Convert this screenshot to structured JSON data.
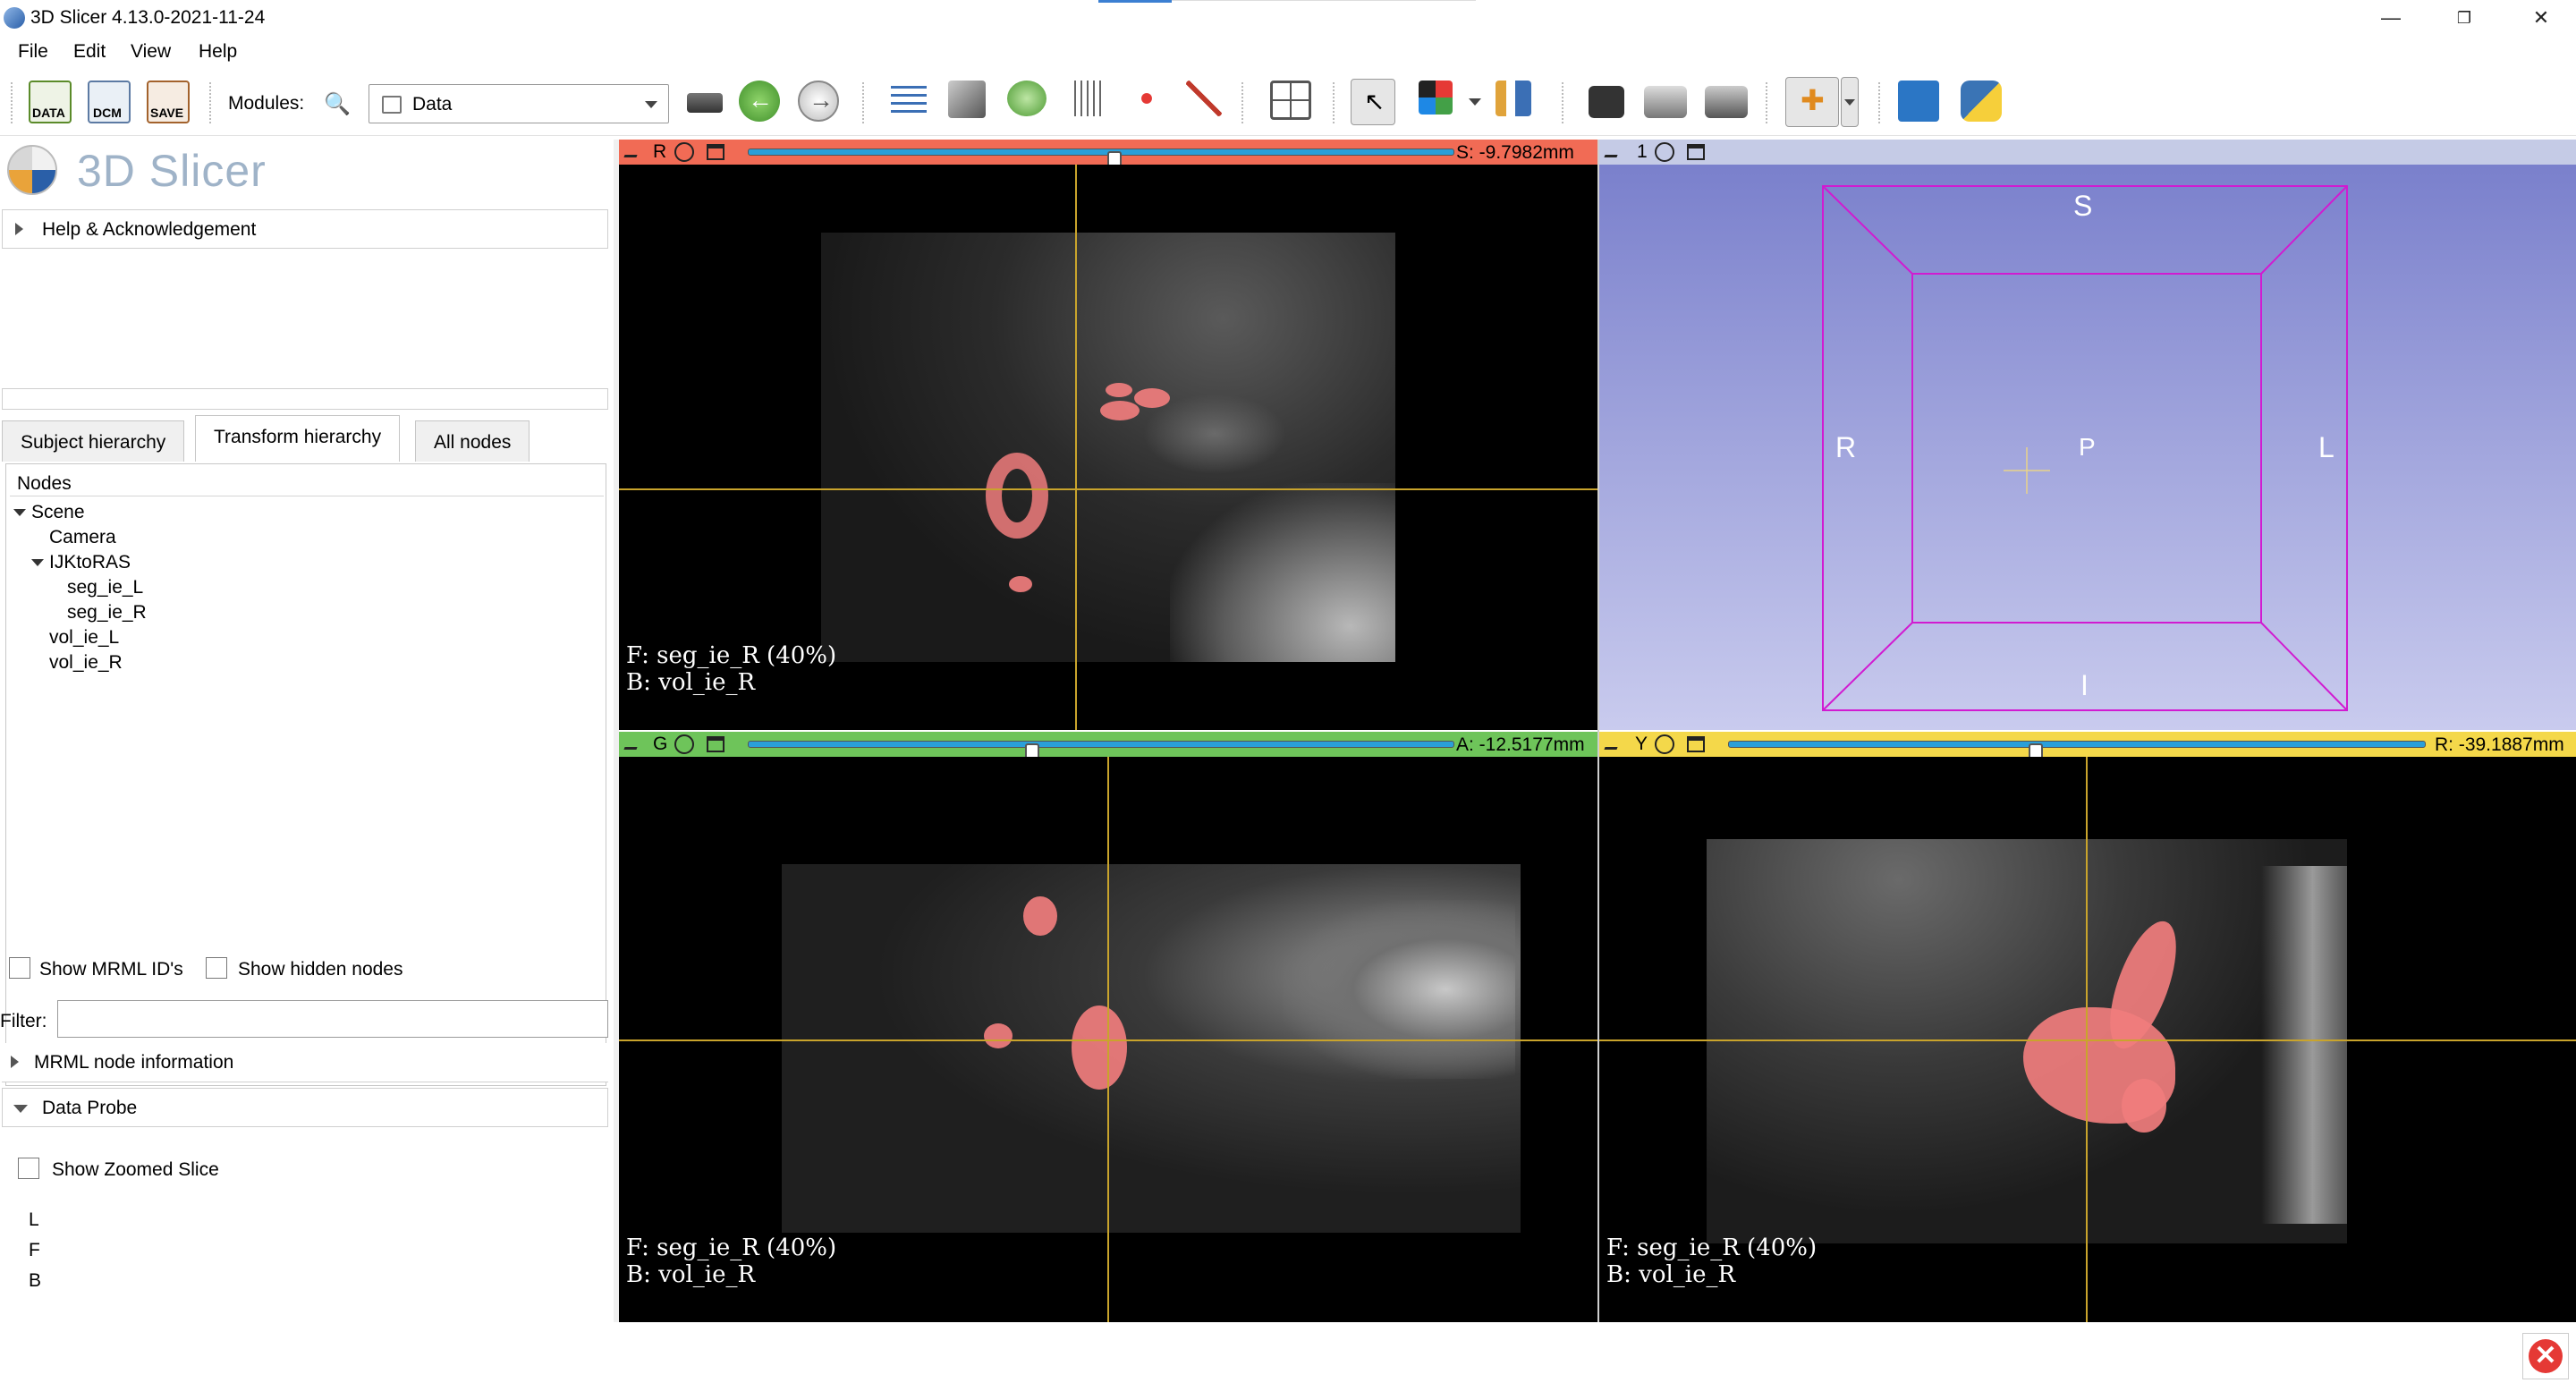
{
  "window": {
    "title": "3D Slicer 4.13.0-2021-11-24",
    "minimize": "—",
    "restore": "❐",
    "close": "✕"
  },
  "menu": [
    "File",
    "Edit",
    "View",
    "Help"
  ],
  "toolbar": {
    "data_btn": "DATA",
    "dcm_btn": "DCM",
    "save_btn": "SAVE",
    "modules_label": "Modules:",
    "module_selected": "Data"
  },
  "left": {
    "logo": "3D Slicer",
    "help_section": "Help & Acknowledgement",
    "tabs": [
      "Subject hierarchy",
      "Transform hierarchy",
      "All nodes"
    ],
    "active_tab": "Transform hierarchy",
    "tree_header": "Nodes",
    "tree": [
      "Scene",
      "Camera",
      "IJKtoRAS",
      "seg_ie_L",
      "seg_ie_R",
      "vol_ie_L",
      "vol_ie_R"
    ],
    "show_mrml_ids": "Show MRML ID's",
    "show_hidden": "Show hidden nodes",
    "filter_label": "Filter:",
    "mrml_info": "MRML node information",
    "data_probe": "Data Probe",
    "show_zoomed": "Show Zoomed Slice",
    "probe_lines": [
      "L",
      "F",
      "B"
    ]
  },
  "views": {
    "red": {
      "label": "R",
      "coord": "S: -9.7982mm",
      "slider_fraction": 0.52,
      "color": "#f16b55",
      "fg": "F: seg_ie_R (40%)",
      "bg": "B: vol_ie_R"
    },
    "threed": {
      "label": "1",
      "color": "#c5cbe6",
      "orient": {
        "S": "S",
        "I": "I",
        "R": "R",
        "L": "L",
        "P": "P"
      }
    },
    "green": {
      "label": "G",
      "coord": "A: -12.5177mm",
      "slider_fraction": 0.4,
      "color": "#6ec45a",
      "fg": "F: seg_ie_R (40%)",
      "bg": "B: vol_ie_R"
    },
    "yellow": {
      "label": "Y",
      "coord": "R: -39.1887mm",
      "slider_fraction": 0.44,
      "color": "#f4d84a",
      "fg": "F: seg_ie_R (40%)",
      "bg": "B: vol_ie_R"
    }
  },
  "colors": {
    "segmentation": "#f07d7d",
    "crosshair": "#c9a42c",
    "threed_box": "#d11bd1",
    "threed_bg_top": "#7a80cc",
    "threed_bg_bottom": "#c9cbee"
  }
}
